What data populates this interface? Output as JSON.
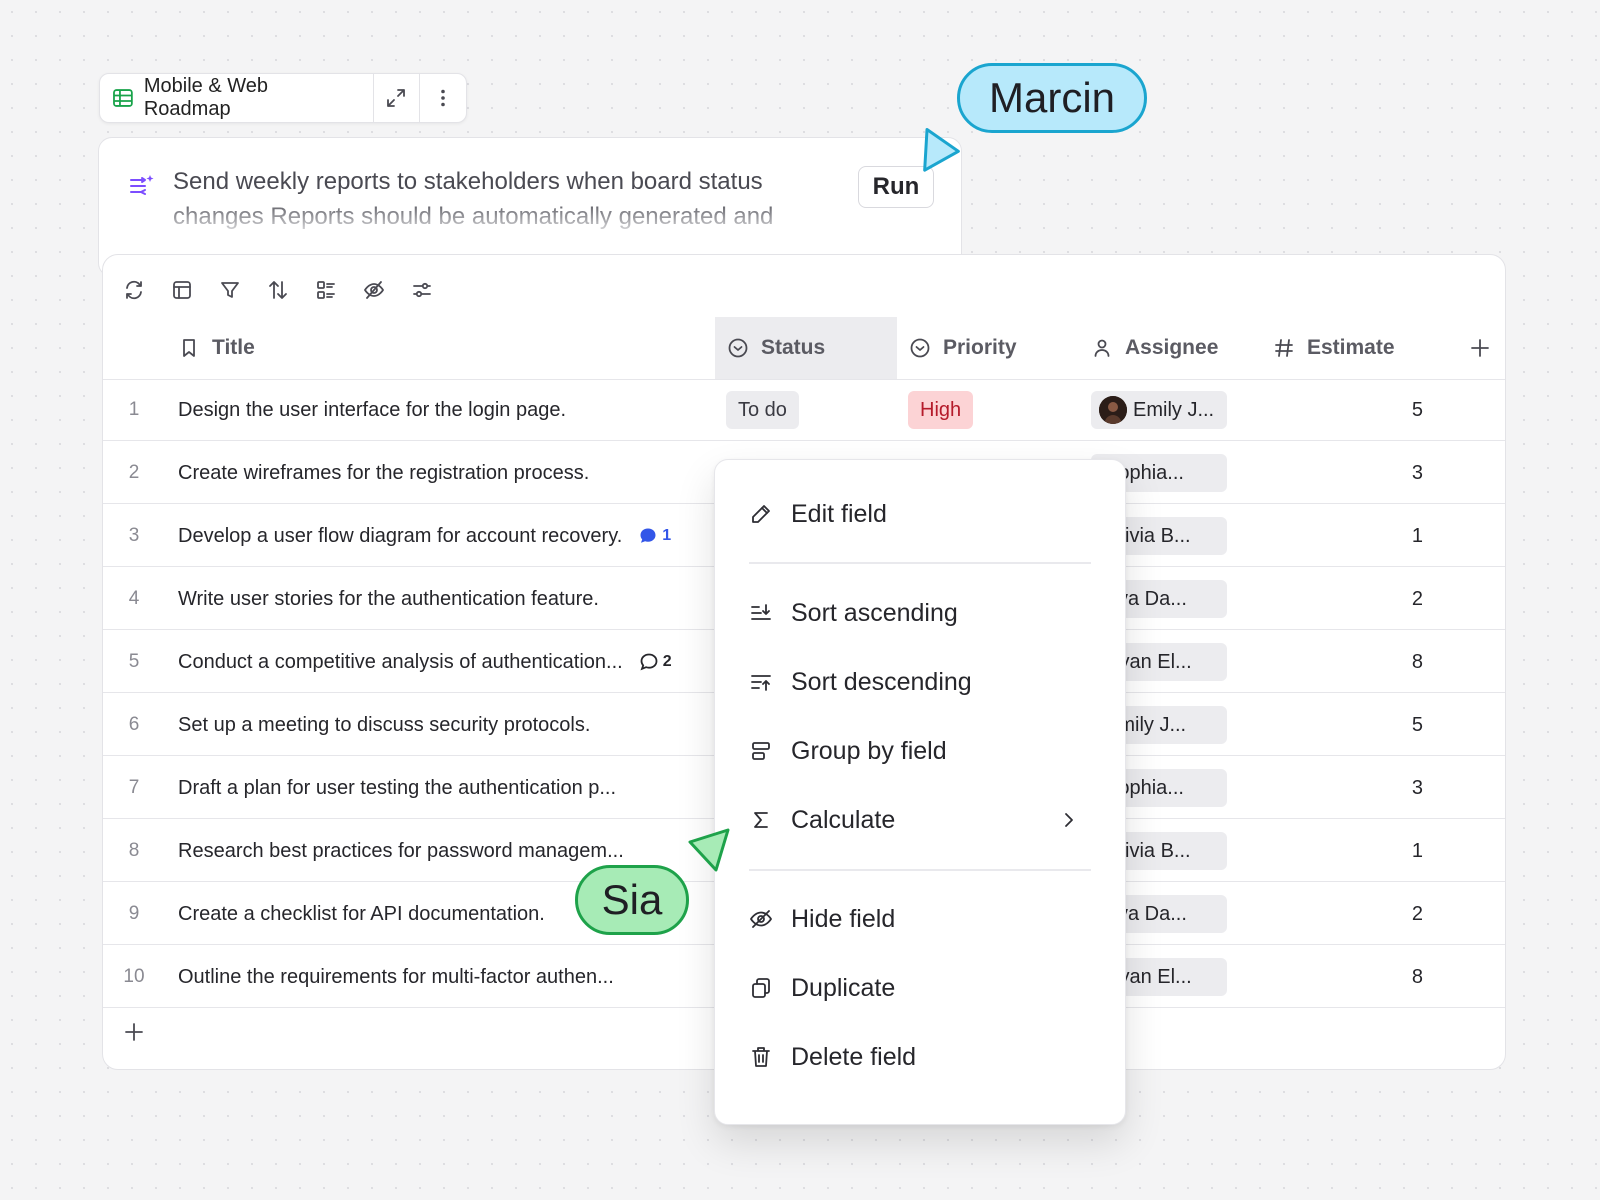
{
  "board": {
    "title": "Mobile & Web Roadmap",
    "icons": [
      "table-icon",
      "expand-icon",
      "more-vertical-icon"
    ]
  },
  "automation": {
    "prompt": "Send weekly reports to stakeholders when board status changes Reports should be automatically generated and",
    "run_label": "Run"
  },
  "toolbar": {
    "icons": [
      "refresh-icon",
      "layout-icon",
      "filter-icon",
      "sort-icon",
      "list-icon",
      "hide-icon",
      "settings-sliders-icon"
    ]
  },
  "columns": {
    "title": "Title",
    "status": "Status",
    "priority": "Priority",
    "assignee": "Assignee",
    "estimate": "Estimate",
    "add": "+"
  },
  "rows": [
    {
      "num": "1",
      "title": "Design the user interface for the login page.",
      "status": "To do",
      "priority": "High",
      "assignee": "Emily J...",
      "estimate": "5",
      "comments": ""
    },
    {
      "num": "2",
      "title": "Create wireframes for the registration process.",
      "status": "",
      "priority": "",
      "assignee": "Sophia...",
      "estimate": "3",
      "comments": ""
    },
    {
      "num": "3",
      "title": "Develop a user flow diagram for account recovery.",
      "status": "",
      "priority": "",
      "assignee": "Olivia B...",
      "estimate": "1",
      "comments": "1"
    },
    {
      "num": "4",
      "title": "Write user stories for the authentication feature.",
      "status": "",
      "priority": "",
      "assignee": "Ava Da...",
      "estimate": "2",
      "comments": ""
    },
    {
      "num": "5",
      "title": "Conduct a competitive analysis of authentication...",
      "status": "",
      "priority": "",
      "assignee": "Ryan El...",
      "estimate": "8",
      "comments": "2"
    },
    {
      "num": "6",
      "title": "Set up a meeting to discuss security protocols.",
      "status": "",
      "priority": "",
      "assignee": "Emily J...",
      "estimate": "5",
      "comments": ""
    },
    {
      "num": "7",
      "title": "Draft a plan for user testing the authentication p...",
      "status": "",
      "priority": "",
      "assignee": "Sophia...",
      "estimate": "3",
      "comments": ""
    },
    {
      "num": "8",
      "title": "Research best practices for password managem...",
      "status": "",
      "priority": "",
      "assignee": "Olivia B...",
      "estimate": "1",
      "comments": ""
    },
    {
      "num": "9",
      "title": "Create a checklist for API documentation.",
      "status": "",
      "priority": "",
      "assignee": "Ava Da...",
      "estimate": "2",
      "comments": ""
    },
    {
      "num": "10",
      "title": "Outline the requirements for multi-factor authen...",
      "status": "",
      "priority": "",
      "assignee": "Ryan El...",
      "estimate": "8",
      "comments": ""
    }
  ],
  "add_row_label": "+",
  "context_menu": {
    "items": [
      {
        "label": "Edit field",
        "icon": "pencil-icon"
      },
      {
        "label": "Sort ascending",
        "icon": "sort-ascending-icon"
      },
      {
        "label": "Sort descending",
        "icon": "sort-descending-icon"
      },
      {
        "label": "Group by field",
        "icon": "group-icon"
      },
      {
        "label": "Calculate",
        "icon": "sigma-icon"
      },
      {
        "label": "Hide field",
        "icon": "eye-off-icon"
      },
      {
        "label": "Duplicate",
        "icon": "duplicate-icon"
      },
      {
        "label": "Delete field",
        "icon": "trash-icon"
      }
    ]
  },
  "collaborators": [
    {
      "name": "Marcin",
      "color": "#1aa5cf",
      "fill": "#b7e9fb"
    },
    {
      "name": "Sia",
      "color": "#1ea24a",
      "fill": "#a7ebb6"
    }
  ],
  "colors": {
    "priority_high_bg": "#fcd3d5",
    "priority_high_text": "#b51b2b",
    "comment_accent": "#3356e8"
  }
}
